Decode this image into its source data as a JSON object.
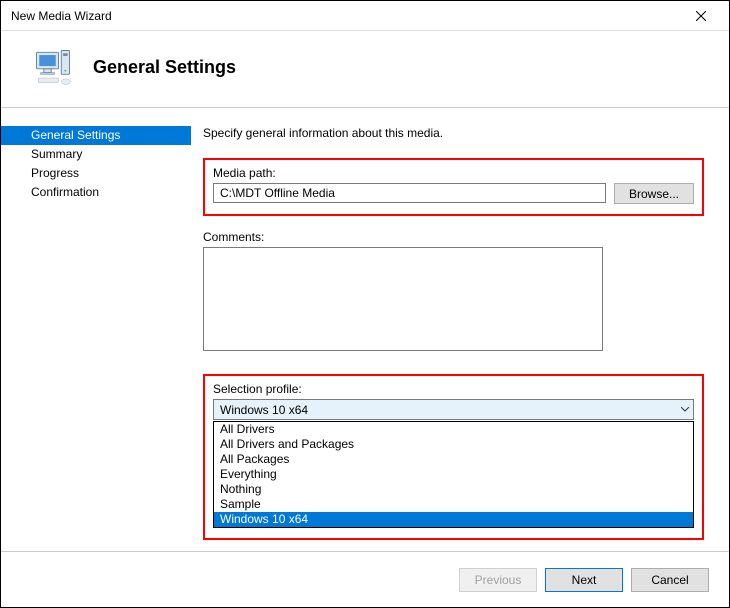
{
  "window": {
    "title": "New Media Wizard"
  },
  "header": {
    "title": "General Settings"
  },
  "sidebar": {
    "items": [
      {
        "label": "General Settings",
        "selected": true
      },
      {
        "label": "Summary",
        "selected": false
      },
      {
        "label": "Progress",
        "selected": false
      },
      {
        "label": "Confirmation",
        "selected": false
      }
    ]
  },
  "content": {
    "instruction": "Specify general information about this media.",
    "media_path_label": "Media path:",
    "media_path_value": "C:\\MDT Offline Media",
    "browse_label": "Browse...",
    "comments_label": "Comments:",
    "comments_value": "",
    "selection_profile_label": "Selection profile:",
    "selection_profile_value": "Windows 10 x64",
    "selection_profile_options": [
      {
        "label": "All Drivers",
        "selected": false
      },
      {
        "label": "All Drivers and Packages",
        "selected": false
      },
      {
        "label": "All Packages",
        "selected": false
      },
      {
        "label": "Everything",
        "selected": false
      },
      {
        "label": "Nothing",
        "selected": false
      },
      {
        "label": "Sample",
        "selected": false
      },
      {
        "label": "Windows 10 x64",
        "selected": true
      }
    ]
  },
  "footer": {
    "previous": "Previous",
    "next": "Next",
    "cancel": "Cancel"
  }
}
